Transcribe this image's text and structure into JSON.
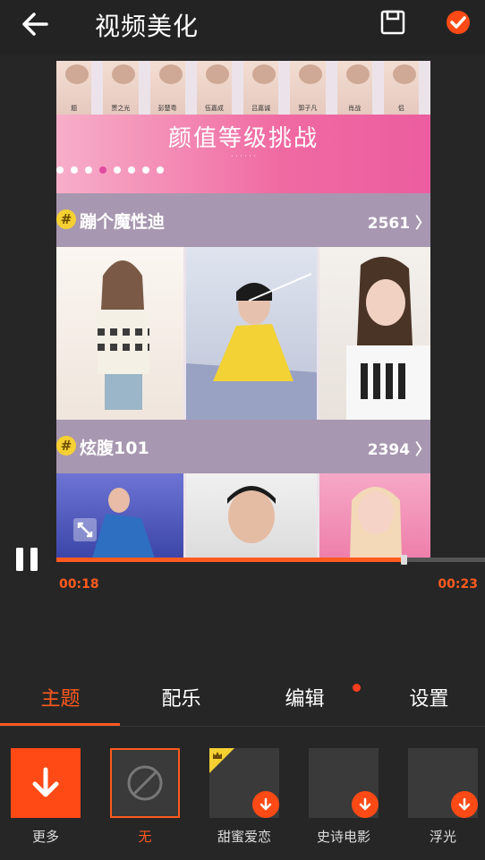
{
  "header": {
    "title": "视频美化"
  },
  "preview": {
    "faces": [
      "题",
      "贾之光",
      "彭楚粤",
      "伍嘉成",
      "吕嘉诚",
      "郭子凡",
      "肖战",
      "侣"
    ],
    "banner_title": "颜值等级挑战",
    "banner_sub": "· · · · · ·",
    "sections": [
      {
        "title": "蹦个魔性迪",
        "count": "2561",
        "arrow": "〉"
      },
      {
        "title": "炫腹101",
        "count": "2394",
        "arrow": "〉"
      }
    ]
  },
  "player": {
    "current_time": "00:18",
    "total_time": "00:23",
    "progress_fraction": 0.81
  },
  "tabs": [
    {
      "label": "主题",
      "active": true
    },
    {
      "label": "配乐",
      "active": false
    },
    {
      "label": "编辑",
      "active": false
    },
    {
      "label": "设置",
      "active": false
    }
  ],
  "themes": [
    {
      "label": "更多",
      "kind": "more"
    },
    {
      "label": "无",
      "kind": "none",
      "selected": true
    },
    {
      "label": "甜蜜爱恋",
      "kind": "download",
      "premium": true
    },
    {
      "label": "史诗电影",
      "kind": "download"
    },
    {
      "label": "浮光",
      "kind": "download"
    }
  ],
  "colors": {
    "accent": "#ff5a1f",
    "background": "#262626",
    "badge": "#ff4a16"
  },
  "icons": [
    "back-arrow-icon",
    "save-icon",
    "check-icon",
    "pause-icon",
    "fullscreen-icon",
    "download-icon",
    "none-icon",
    "crown-icon"
  ]
}
